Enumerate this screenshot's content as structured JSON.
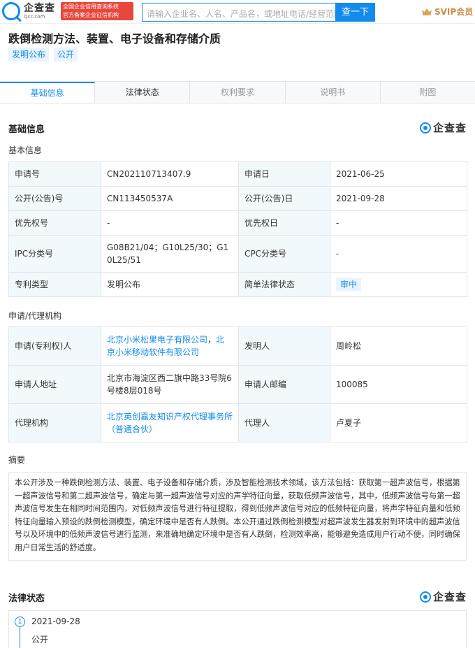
{
  "header": {
    "logo_text": "企查查",
    "logo_sub": "Qcc.com",
    "cert_line1": "全国企业信用查询系统",
    "cert_line2": "官方备案企业征信机构",
    "search_placeholder": "请输入企业名、人名、产品名，或地址电话/经营范围",
    "search_button": "查一下",
    "svip_label": "SVIP会员"
  },
  "patent": {
    "title": "跌倒检测方法、装置、电子设备和存储介质",
    "tags": [
      "发明公布",
      "公开"
    ]
  },
  "tabs": [
    {
      "label": "基础信息",
      "state": "active"
    },
    {
      "label": "法律状态",
      "state": "normal"
    },
    {
      "label": "权利要求",
      "state": "disabled"
    },
    {
      "label": "说明书",
      "state": "disabled"
    },
    {
      "label": "附图",
      "state": "disabled"
    }
  ],
  "basic": {
    "section_title": "基础信息",
    "brand": "企查查",
    "subsection": "基本信息",
    "rows": [
      {
        "k1": "申请号",
        "v1": "CN202110713407.9",
        "k2": "申请日",
        "v2": "2021-06-25"
      },
      {
        "k1": "公开(公告)号",
        "v1": "CN113450537A",
        "k2": "公开(公告)日",
        "v2": "2021-09-28"
      },
      {
        "k1": "优先权号",
        "v1": "-",
        "k2": "优先权日",
        "v2": "-"
      },
      {
        "k1": "IPC分类号",
        "v1": "G08B21/04；G10L25/30；G10L25/51",
        "k2": "CPC分类号",
        "v2": "-"
      },
      {
        "k1": "专利类型",
        "v1": "发明公布",
        "k2": "简单法律状态",
        "v2": "审中"
      }
    ]
  },
  "agency": {
    "subsection": "申请/代理机构",
    "applicant_label": "申请(专利权)人",
    "applicant_1": "北京小米松果电子有限公司",
    "applicant_sep": "，",
    "applicant_2": "北京小米移动软件有限公司",
    "inventor_label": "发明人",
    "inventor": "周岭松",
    "address_label": "申请人地址",
    "address": "北京市海淀区西二旗中路33号院6号楼8层018号",
    "zip_label": "申请人邮编",
    "zip": "100085",
    "agency_label": "代理机构",
    "agency_name": "北京英创嘉友知识产权代理事务所（普通合伙）",
    "agent_label": "代理人",
    "agent": "卢夏子"
  },
  "abstract": {
    "title": "摘要",
    "text": "本公开涉及一种跌倒检测方法、装置、电子设备和存储介质，涉及智能检测技术领域，该方法包括：获取第一超声波信号，根据第一超声波信号和第二超声波信号，确定与第一超声波信号对应的声学特征向量，获取低频声波信号，其中，低频声波信号与第一超声波信号发生在相同时间范围内，对低频声波信号进行特征提取，得到低频声波信号对应的低频特征向量，将声学特征向量和低频特征向量输入预设的跌倒检测模型，确定环境中是否有人跌倒。本公开通过跌倒检测模型对超声波发生器发射到环境中的超声波信号以及环境中的低频声波信号进行监测，来准确地确定环境中是否有人跌倒，检测效率高，能够避免造成用户行动不便，同时确保用户日常生活的舒适度。"
  },
  "legal": {
    "section_title": "法律状态",
    "brand": "企查查",
    "items": [
      {
        "num": "1",
        "date": "2021-09-28",
        "status": "公开"
      }
    ]
  }
}
